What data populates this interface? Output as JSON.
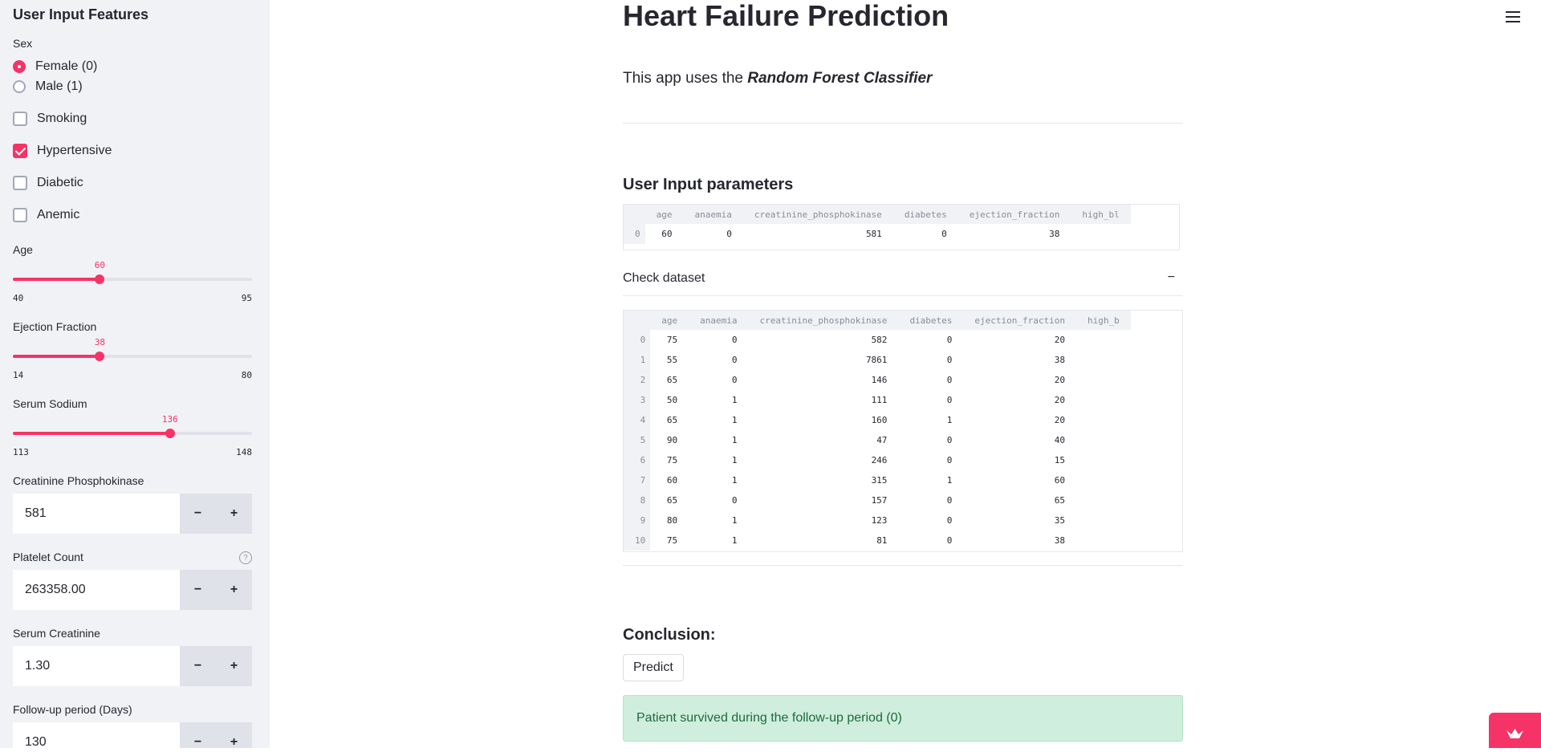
{
  "sidebar": {
    "title": "User Input Features",
    "sex": {
      "label": "Sex",
      "options": [
        "Female (0)",
        "Male (1)"
      ],
      "selected": "Female (0)"
    },
    "checkboxes": [
      {
        "label": "Smoking",
        "checked": false
      },
      {
        "label": "Hypertensive",
        "checked": true
      },
      {
        "label": "Diabetic",
        "checked": false
      },
      {
        "label": "Anemic",
        "checked": false
      }
    ],
    "sliders": [
      {
        "label": "Age",
        "min": 40,
        "max": 95,
        "value": 60
      },
      {
        "label": "Ejection Fraction",
        "min": 14,
        "max": 80,
        "value": 38
      },
      {
        "label": "Serum Sodium",
        "min": 113,
        "max": 148,
        "value": 136
      }
    ],
    "number_inputs": [
      {
        "label": "Creatinine Phosphokinase",
        "value": "581",
        "help": false
      },
      {
        "label": "Platelet Count",
        "value": "263358.00",
        "help": true
      },
      {
        "label": "Serum Creatinine",
        "value": "1.30",
        "help": false
      },
      {
        "label": "Follow-up period (Days)",
        "value": "130",
        "help": false
      }
    ],
    "stepper": {
      "minus": "−",
      "plus": "+"
    },
    "help_glyph": "?"
  },
  "main": {
    "title": "Heart Failure Prediction",
    "intro_prefix": "This app uses the ",
    "intro_emph": "Random Forest Classifier",
    "input_params_heading": "User Input parameters",
    "input_table": {
      "columns": [
        "",
        "age",
        "anaemia",
        "creatinine_phosphokinase",
        "diabetes",
        "ejection_fraction",
        "high_bl"
      ],
      "rows": [
        [
          "0",
          "60",
          "0",
          "581",
          "0",
          "38",
          ""
        ]
      ]
    },
    "expander": {
      "label": "Check dataset",
      "toggle": "−"
    },
    "dataset_table": {
      "columns": [
        "",
        "age",
        "anaemia",
        "creatinine_phosphokinase",
        "diabetes",
        "ejection_fraction",
        "high_b"
      ],
      "rows": [
        [
          "0",
          "75",
          "0",
          "582",
          "0",
          "20",
          ""
        ],
        [
          "1",
          "55",
          "0",
          "7861",
          "0",
          "38",
          ""
        ],
        [
          "2",
          "65",
          "0",
          "146",
          "0",
          "20",
          ""
        ],
        [
          "3",
          "50",
          "1",
          "111",
          "0",
          "20",
          ""
        ],
        [
          "4",
          "65",
          "1",
          "160",
          "1",
          "20",
          ""
        ],
        [
          "5",
          "90",
          "1",
          "47",
          "0",
          "40",
          ""
        ],
        [
          "6",
          "75",
          "1",
          "246",
          "0",
          "15",
          ""
        ],
        [
          "7",
          "60",
          "1",
          "315",
          "1",
          "60",
          ""
        ],
        [
          "8",
          "65",
          "0",
          "157",
          "0",
          "65",
          ""
        ],
        [
          "9",
          "80",
          "1",
          "123",
          "0",
          "35",
          ""
        ],
        [
          "10",
          "75",
          "1",
          "81",
          "0",
          "38",
          ""
        ]
      ]
    },
    "conclusion_heading": "Conclusion:",
    "predict_button": "Predict",
    "result": "Patient survived during the follow-up period (0)"
  },
  "colors": {
    "accent": "#f63366",
    "sidebar_bg": "#f0f2f6",
    "success_bg": "#cfeedd",
    "success_text": "#1e6a3c"
  },
  "icons": {
    "menu": "hamburger-icon",
    "badge": "streamlit-crown-icon"
  }
}
